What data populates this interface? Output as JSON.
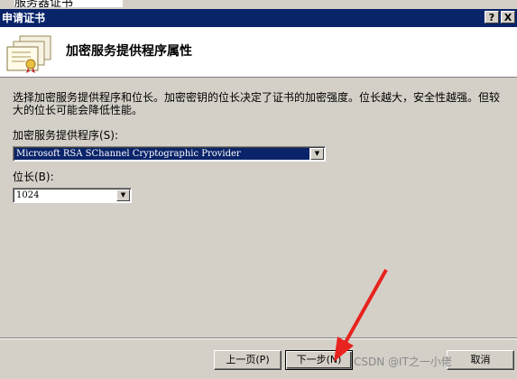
{
  "background_window": {
    "title_fragment": "服务器证书"
  },
  "dialog": {
    "title": "申请证书",
    "help_button": "?",
    "close_button": "X"
  },
  "header": {
    "title": "加密服务提供程序属性"
  },
  "description": "选择加密服务提供程序和位长。加密密钥的位长决定了证书的加密强度。位长越大，安全性越强。但较大的位长可能会降低性能。",
  "csp": {
    "label": "加密服务提供程序(S):",
    "value": "Microsoft RSA SChannel Cryptographic Provider"
  },
  "bit_length": {
    "label": "位长(B):",
    "value": "1024"
  },
  "buttons": {
    "back": "上一页(P)",
    "next": "下一步(N)",
    "cancel": "取消"
  },
  "watermark": "CSDN @IT之一小佬",
  "colors": {
    "titlebar": "#0a246a",
    "selection": "#0a246a",
    "face": "#d4d0c8",
    "annotation_arrow": "#e8231f"
  }
}
